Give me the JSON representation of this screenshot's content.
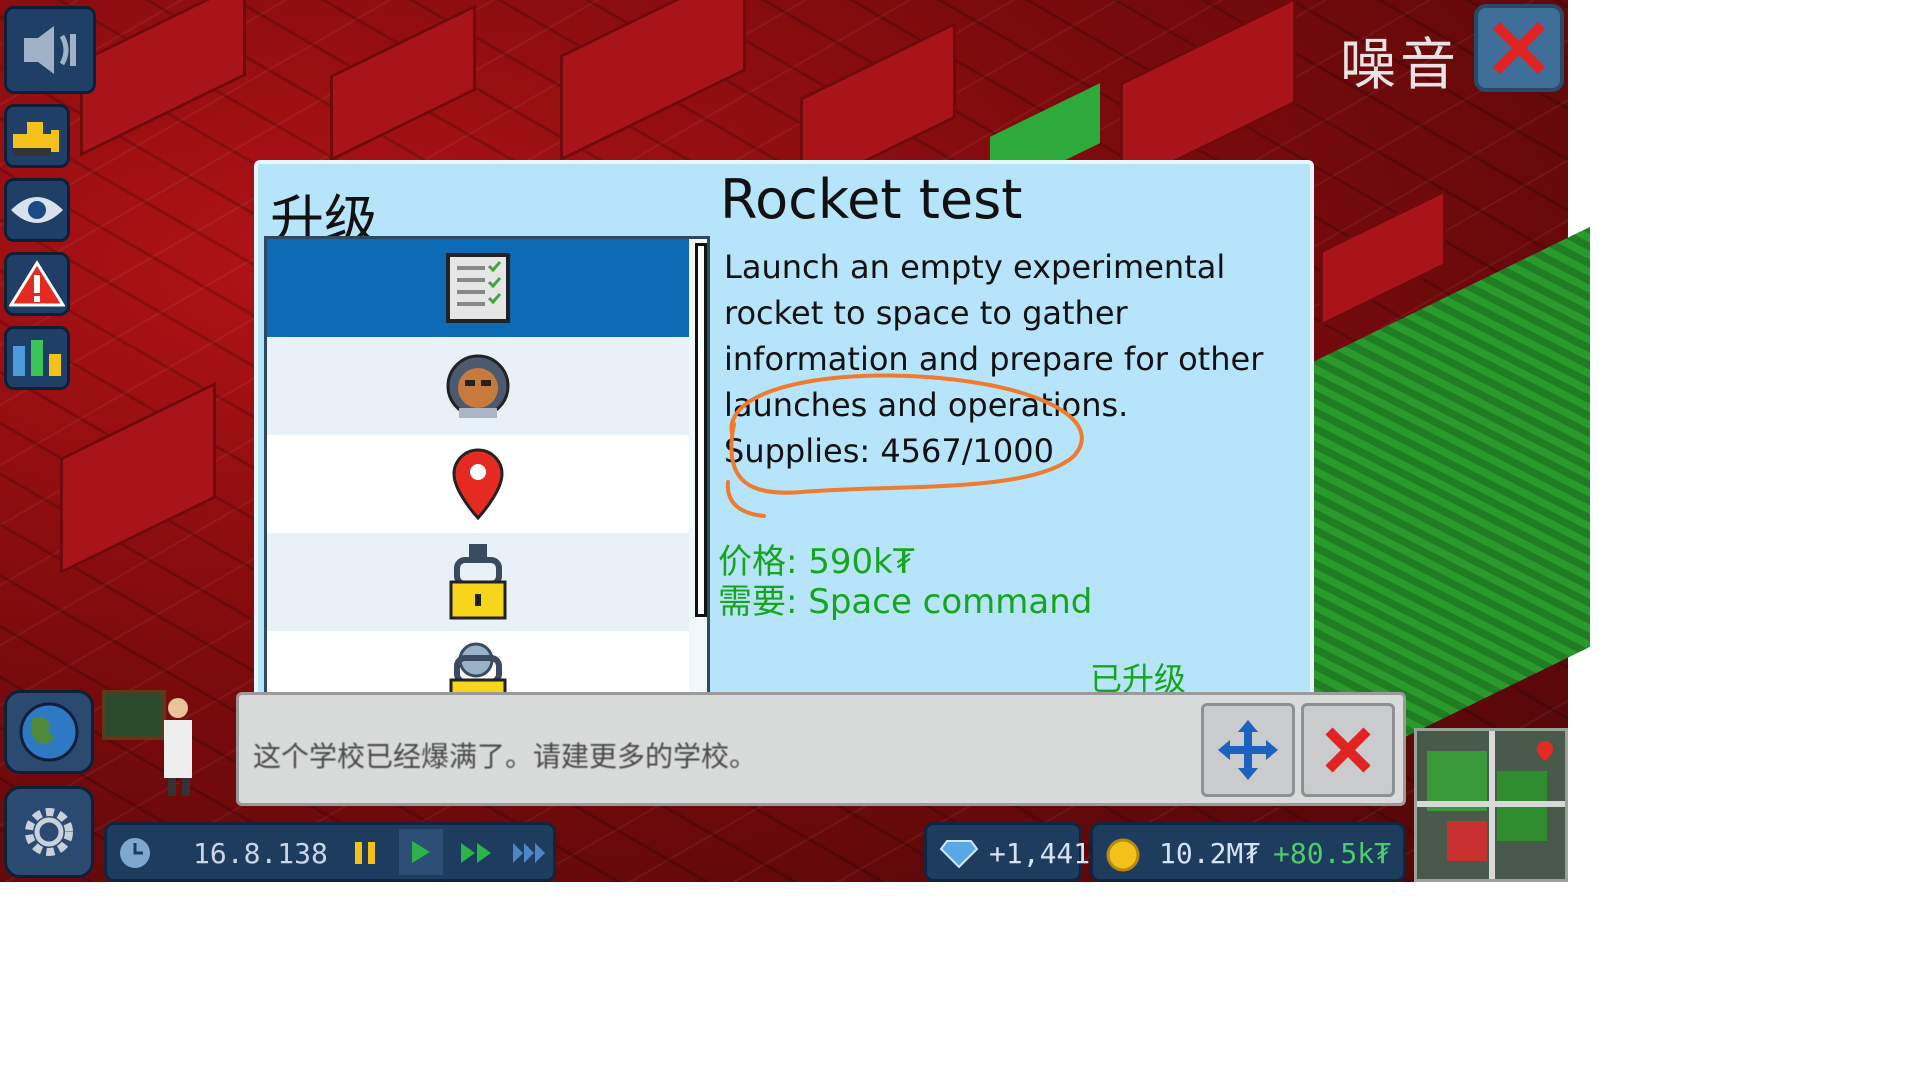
{
  "header": {
    "noise_label": "噪音"
  },
  "dialog": {
    "left_title": "升级",
    "upgrade_list": [
      {
        "icon": "checklist-document-icon",
        "state": "selected"
      },
      {
        "icon": "astronaut-helmet-icon",
        "state": "available"
      },
      {
        "icon": "map-pin-icon",
        "state": "available"
      },
      {
        "icon": "padlock-locked-icon",
        "state": "locked"
      },
      {
        "icon": "padlock-locked-icon",
        "state": "locked"
      }
    ],
    "detail": {
      "title": "Rocket test",
      "description": "Launch an empty experimental rocket to space to gather information and prepare for other launches and operations.",
      "supplies": "Supplies: 4567/1000",
      "price": "价格: 590k₮",
      "requires": "需要: Space command",
      "status": "已升级"
    }
  },
  "message": {
    "text": "这个学校已经爆满了。请建更多的学校。"
  },
  "status_bar": {
    "date": "16.8.138",
    "diamonds": "+1,441",
    "money": "10.2M₮",
    "income": "+80.5k₮"
  },
  "colors": {
    "dialog_bg": "#b6e4fa",
    "selected_item": "#0d6ab5",
    "green_text": "#17a51e",
    "annotation": "#f07a2e",
    "close_red": "#e02323"
  }
}
